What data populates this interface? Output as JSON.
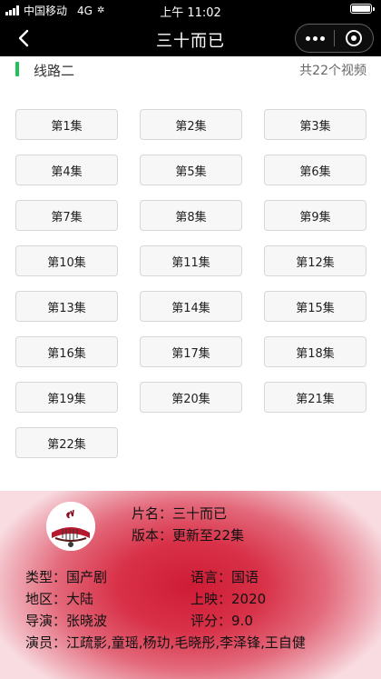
{
  "status_bar": {
    "carrier": "中国移动",
    "network": "4G",
    "time": "上午 11:02"
  },
  "nav": {
    "title": "三十而已"
  },
  "route": {
    "name": "线路二",
    "count": "共22个视频"
  },
  "episodes": [
    "第1集",
    "第2集",
    "第3集",
    "第4集",
    "第5集",
    "第6集",
    "第7集",
    "第8集",
    "第9集",
    "第10集",
    "第11集",
    "第12集",
    "第13集",
    "第14集",
    "第15集",
    "第16集",
    "第17集",
    "第18集",
    "第19集",
    "第20集",
    "第21集",
    "第22集"
  ],
  "movie": {
    "title_label": "片名：",
    "title": "三十而已",
    "version_label": "版本：",
    "version": "更新至22集",
    "genre_label": "类型：",
    "genre": "国产剧",
    "language_label": "语言：",
    "language": "国语",
    "region_label": "地区：",
    "region": "大陆",
    "release_label": "上映：",
    "release": "2020",
    "director_label": "导演：",
    "director": "张晓波",
    "rating_label": "评分：",
    "rating": "9.0",
    "cast_label": "演员：",
    "cast": "江疏影,童瑶,杨玏,毛晓彤,李泽锋,王自健"
  },
  "colors": {
    "accent_green": "#21c15a",
    "info_red": "#cf1c36"
  },
  "icons": {
    "back": "chevron-left-icon",
    "more": "more-dots-icon",
    "close": "target-circle-icon",
    "battery": "battery-icon",
    "signal": "signal-icon"
  }
}
